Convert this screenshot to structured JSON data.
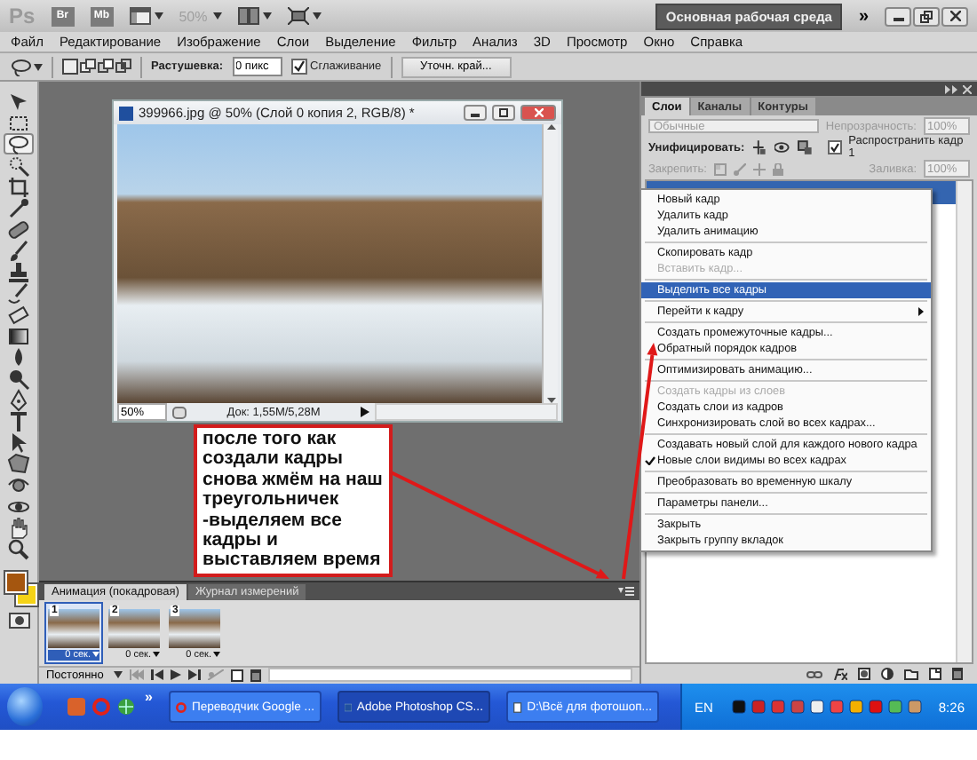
{
  "title_bar": {
    "app_logo": "Ps",
    "launch_buttons": [
      "Br",
      "Mb"
    ],
    "zoom": {
      "value": "50%",
      "disabled": true
    },
    "workspace_button": "Основная рабочая среда",
    "overflow": "»"
  },
  "menu_bar": [
    "Файл",
    "Редактирование",
    "Изображение",
    "Слои",
    "Выделение",
    "Фильтр",
    "Анализ",
    "3D",
    "Просмотр",
    "Окно",
    "Справка"
  ],
  "options_bar": {
    "feather_label": "Растушевка:",
    "feather_value": "0 пикс",
    "antialias": {
      "label": "Сглаживание",
      "checked": true
    },
    "refine_button": "Уточн. край..."
  },
  "tools": [
    {
      "kind": "move",
      "selected": false
    },
    {
      "kind": "marquee",
      "selected": false
    },
    {
      "kind": "lasso",
      "selected": true
    },
    {
      "kind": "quick-select",
      "selected": false
    },
    {
      "kind": "crop",
      "selected": false
    },
    {
      "kind": "eyedropper",
      "selected": false
    },
    {
      "kind": "healing",
      "selected": false
    },
    {
      "kind": "brush",
      "selected": false
    },
    {
      "kind": "stamp",
      "selected": false
    },
    {
      "kind": "history",
      "selected": false
    },
    {
      "kind": "eraser",
      "selected": false
    },
    {
      "kind": "gradient",
      "selected": false
    },
    {
      "kind": "blur",
      "selected": false
    },
    {
      "kind": "dodge",
      "selected": false
    },
    {
      "kind": "pen",
      "selected": false
    },
    {
      "kind": "type",
      "selected": false
    },
    {
      "kind": "path-select",
      "selected": false
    },
    {
      "kind": "shape",
      "selected": false
    },
    {
      "kind": "rotate-3d",
      "selected": false
    },
    {
      "kind": "orbit-3d",
      "selected": false
    },
    {
      "kind": "hand",
      "selected": false
    },
    {
      "kind": "zoom",
      "selected": false
    }
  ],
  "swatches": [
    {
      "kind": "foreground",
      "color": "#a5560f"
    },
    {
      "kind": "background",
      "color": "#f5d316"
    }
  ],
  "document": {
    "title": "399966.jpg @ 50% (Слой 0 копия 2, RGB/8) *",
    "zoom": "50%",
    "info": "Док: 1,55M/5,28M"
  },
  "annotation": "после того как создали кадры снова жмём на наш треугольничек -выделяем все кадры и выставляем время",
  "animation_panel": {
    "tabs": [
      {
        "label": "Анимация (покадровая)",
        "selected": true
      },
      {
        "label": "Журнал измерений",
        "selected": false
      }
    ],
    "frames": [
      {
        "number": "1",
        "delay": "0 сек.",
        "selected": true
      },
      {
        "number": "2",
        "delay": "0 сек.",
        "selected": false
      },
      {
        "number": "3",
        "delay": "0 сек.",
        "selected": false
      }
    ],
    "loop": "Постоянно"
  },
  "layers_panel": {
    "tabs": [
      {
        "label": "Слои",
        "selected": true
      },
      {
        "label": "Каналы",
        "selected": false
      },
      {
        "label": "Контуры",
        "selected": false
      }
    ],
    "disabled": true,
    "blend_mode": "Обычные",
    "opacity_label": "Непрозрачность:",
    "opacity_value": "100%",
    "unify_label": "Унифицировать:",
    "propagate": {
      "label": "Распространить кадр 1",
      "checked": true
    },
    "lock_label": "Закрепить:",
    "fill_label": "Заливка:",
    "fill_value": "100%"
  },
  "panel_menu": [
    {
      "kind": "item",
      "label": "Новый кадр",
      "disabled": false,
      "selected": false,
      "checked": false,
      "submenu": false
    },
    {
      "kind": "item",
      "label": "Удалить кадр",
      "disabled": false,
      "selected": false,
      "checked": false,
      "submenu": false
    },
    {
      "kind": "item",
      "label": "Удалить анимацию",
      "disabled": false,
      "selected": false,
      "checked": false,
      "submenu": false
    },
    {
      "kind": "separator"
    },
    {
      "kind": "item",
      "label": "Скопировать кадр",
      "disabled": false,
      "selected": false,
      "checked": false,
      "submenu": false
    },
    {
      "kind": "item",
      "label": "Вставить кадр...",
      "disabled": true,
      "selected": false,
      "checked": false,
      "submenu": false
    },
    {
      "kind": "separator"
    },
    {
      "kind": "item",
      "label": "Выделить все кадры",
      "disabled": false,
      "selected": true,
      "checked": false,
      "submenu": false
    },
    {
      "kind": "separator"
    },
    {
      "kind": "item",
      "label": "Перейти к кадру",
      "disabled": false,
      "selected": false,
      "checked": false,
      "submenu": true
    },
    {
      "kind": "separator"
    },
    {
      "kind": "item",
      "label": "Создать промежуточные кадры...",
      "disabled": false,
      "selected": false,
      "checked": false,
      "submenu": false
    },
    {
      "kind": "item",
      "label": "Обратный порядок кадров",
      "disabled": false,
      "selected": false,
      "checked": false,
      "submenu": false
    },
    {
      "kind": "separator"
    },
    {
      "kind": "item",
      "label": "Оптимизировать анимацию...",
      "disabled": false,
      "selected": false,
      "checked": false,
      "submenu": false
    },
    {
      "kind": "separator"
    },
    {
      "kind": "item",
      "label": "Создать кадры из слоев",
      "disabled": true,
      "selected": false,
      "checked": false,
      "submenu": false
    },
    {
      "kind": "item",
      "label": "Создать слои из кадров",
      "disabled": false,
      "selected": false,
      "checked": false,
      "submenu": false
    },
    {
      "kind": "item",
      "label": "Синхронизировать слой во всех кадрах...",
      "disabled": false,
      "selected": false,
      "checked": false,
      "submenu": false
    },
    {
      "kind": "separator"
    },
    {
      "kind": "item",
      "label": "Создавать новый слой для каждого нового кадра",
      "disabled": false,
      "selected": false,
      "checked": false,
      "submenu": false
    },
    {
      "kind": "item",
      "label": "Новые слои видимы во всех кадрах",
      "disabled": false,
      "selected": false,
      "checked": true,
      "submenu": false
    },
    {
      "kind": "separator"
    },
    {
      "kind": "item",
      "label": "Преобразовать во временную шкалу",
      "disabled": false,
      "selected": false,
      "checked": false,
      "submenu": false
    },
    {
      "kind": "separator"
    },
    {
      "kind": "item",
      "label": "Параметры панели...",
      "disabled": false,
      "selected": false,
      "checked": false,
      "submenu": false
    },
    {
      "kind": "separator"
    },
    {
      "kind": "item",
      "label": "Закрыть",
      "disabled": false,
      "selected": false,
      "checked": false,
      "submenu": false
    },
    {
      "kind": "item",
      "label": "Закрыть группу вкладок",
      "disabled": false,
      "selected": false,
      "checked": false,
      "submenu": false
    }
  ],
  "taskbar": {
    "overflow": "»",
    "tasks": [
      {
        "label": "Переводчик Google ...",
        "selected": false
      },
      {
        "label": "Adobe Photoshop CS...",
        "selected": true
      },
      {
        "label": "D:\\Всё для фотошоп...",
        "selected": false
      }
    ],
    "language": "EN",
    "clock": "8:26"
  }
}
